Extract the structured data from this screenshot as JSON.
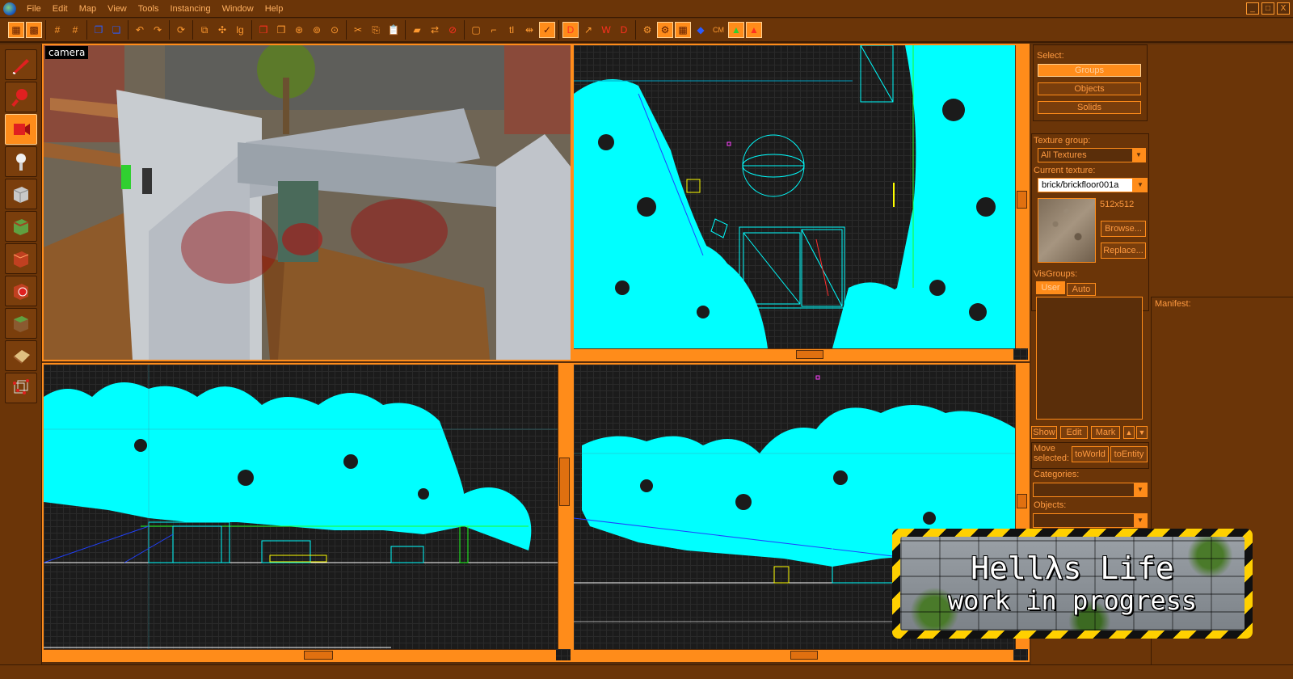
{
  "menu": {
    "items": [
      "File",
      "Edit",
      "Map",
      "View",
      "Tools",
      "Instancing",
      "Window",
      "Help"
    ]
  },
  "window_controls": [
    "_",
    "□",
    "X"
  ],
  "toolbar": {
    "cm_label": "CM",
    "groups": [
      [
        "grid-toggle-icon",
        "grid-3d-icon"
      ],
      [
        "grid-smaller-icon",
        "grid-larger-icon"
      ],
      [
        "copy-icon",
        "paste-icon"
      ],
      [
        "undo-icon",
        "redo-icon"
      ],
      [
        "refresh-icon"
      ],
      [
        "carve-icon",
        "hollow-icon",
        "lg-icon"
      ],
      [
        "group-icon",
        "ungroup-icon",
        "tie-icon",
        "move-to-world-icon",
        "hide-icon"
      ],
      [
        "cut-icon",
        "copy2-icon",
        "paste2-icon"
      ],
      [
        "texture-lock-icon",
        "texture-apply-icon",
        "stop-icon"
      ],
      [
        "select-box-icon",
        "select-icon",
        "tl-icon",
        "align-icon",
        "flip-icon"
      ],
      [
        "dd-icon",
        "dt-icon",
        "w-icon",
        "dr-icon"
      ],
      [
        "run-map-icon",
        "entity-report-icon",
        "check-icon",
        "cube-icon",
        "cm-icon",
        "load-pointfile-icon",
        "load-portalfile-icon"
      ]
    ]
  },
  "palette": {
    "tools": [
      {
        "name": "selection-tool-icon",
        "color": "#e02020"
      },
      {
        "name": "magnify-tool-icon",
        "color": "#e02020"
      },
      {
        "name": "camera-tool-icon",
        "color": "#e02020",
        "active": true
      },
      {
        "name": "entity-tool-icon",
        "color": "#f0f0f0"
      },
      {
        "name": "block-tool-icon",
        "color": "#d0d0d0"
      },
      {
        "name": "texture-application-icon",
        "color": "#60a040"
      },
      {
        "name": "apply-texture-icon",
        "color": "#c04020"
      },
      {
        "name": "decal-tool-icon",
        "color": "#c04020"
      },
      {
        "name": "overlay-tool-icon",
        "color": "#60a040"
      },
      {
        "name": "clipping-tool-icon",
        "color": "#e0c080"
      },
      {
        "name": "vertex-tool-icon",
        "color": "#e02020"
      }
    ]
  },
  "viewports": {
    "camera_label": "camera"
  },
  "right_panel": {
    "select_label": "Select:",
    "select_buttons": [
      "Groups",
      "Objects",
      "Solids"
    ],
    "texture_group_label": "Texture group:",
    "texture_group_value": "All Textures",
    "current_texture_label": "Current texture:",
    "current_texture_value": "brick/brickfloor001a",
    "texture_size": "512x512",
    "browse_label": "Browse...",
    "replace_label": "Replace...",
    "visgroups_label": "VisGroups:",
    "tabs": [
      "User",
      "Auto"
    ],
    "visgroup_buttons": [
      "Show",
      "Edit",
      "Mark"
    ],
    "up_arrow": "▲",
    "down_arrow": "▼",
    "move_selected_label": "Move selected:",
    "to_world_label": "toWorld",
    "to_entity_label": "toEntity",
    "categories_label": "Categories:",
    "objects_label": "Objects:",
    "manifest_label": "Manifest:"
  },
  "banner": {
    "title": "Hellλs Life",
    "subtitle": "work in progress"
  },
  "colors": {
    "accent": "#ff8c1a",
    "panel": "#6b3508",
    "wire": "#00ffff"
  }
}
